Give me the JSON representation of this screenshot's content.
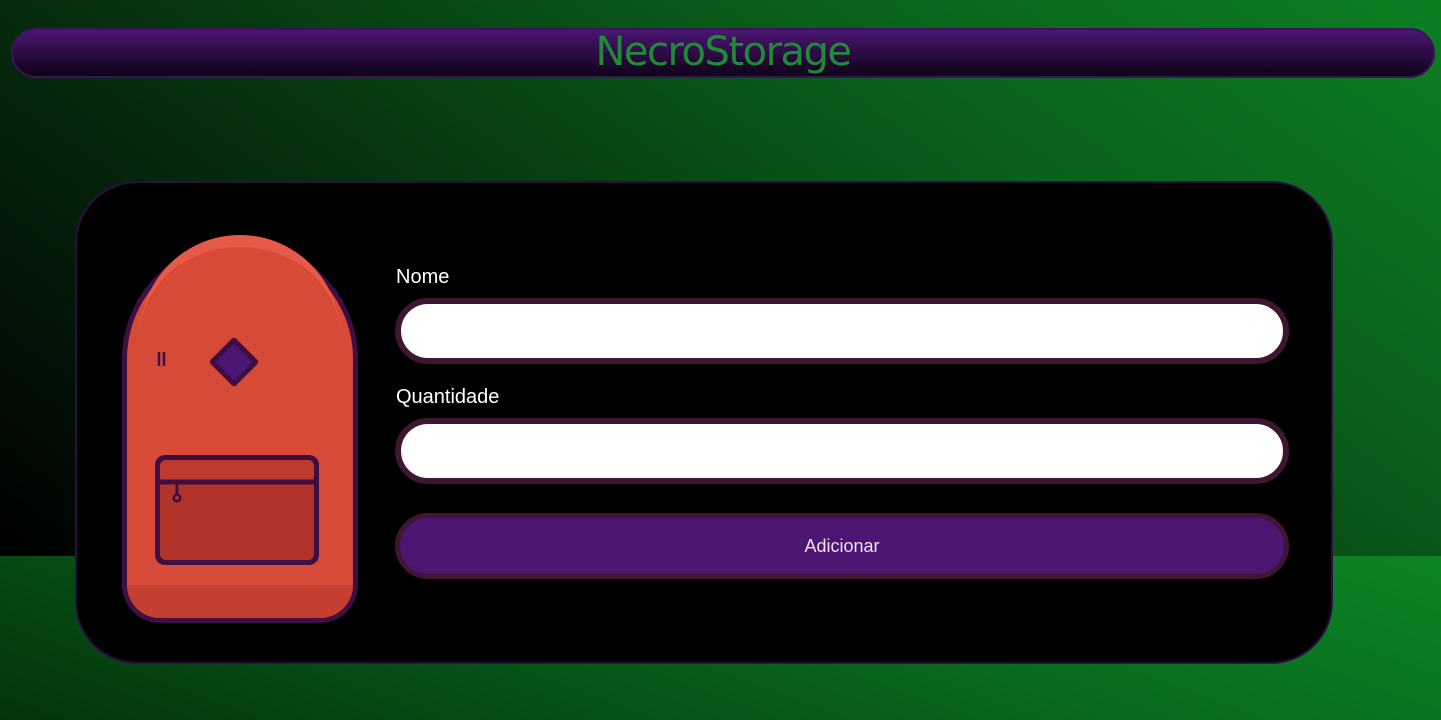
{
  "app": {
    "title": "NecroStorage"
  },
  "form": {
    "name_label": "Nome",
    "name_value": "",
    "name_placeholder": "",
    "quantity_label": "Quantidade",
    "quantity_value": "",
    "quantity_placeholder": "",
    "submit_label": "Adicionar"
  },
  "icons": {
    "illustration": "backpack-icon"
  },
  "colors": {
    "title_green": "#1f8a38",
    "header_purple": "#4a1672",
    "button_purple": "#4c1572",
    "input_border": "#3e1533",
    "card_background": "#000000",
    "backpack_red": "#d84a38"
  }
}
